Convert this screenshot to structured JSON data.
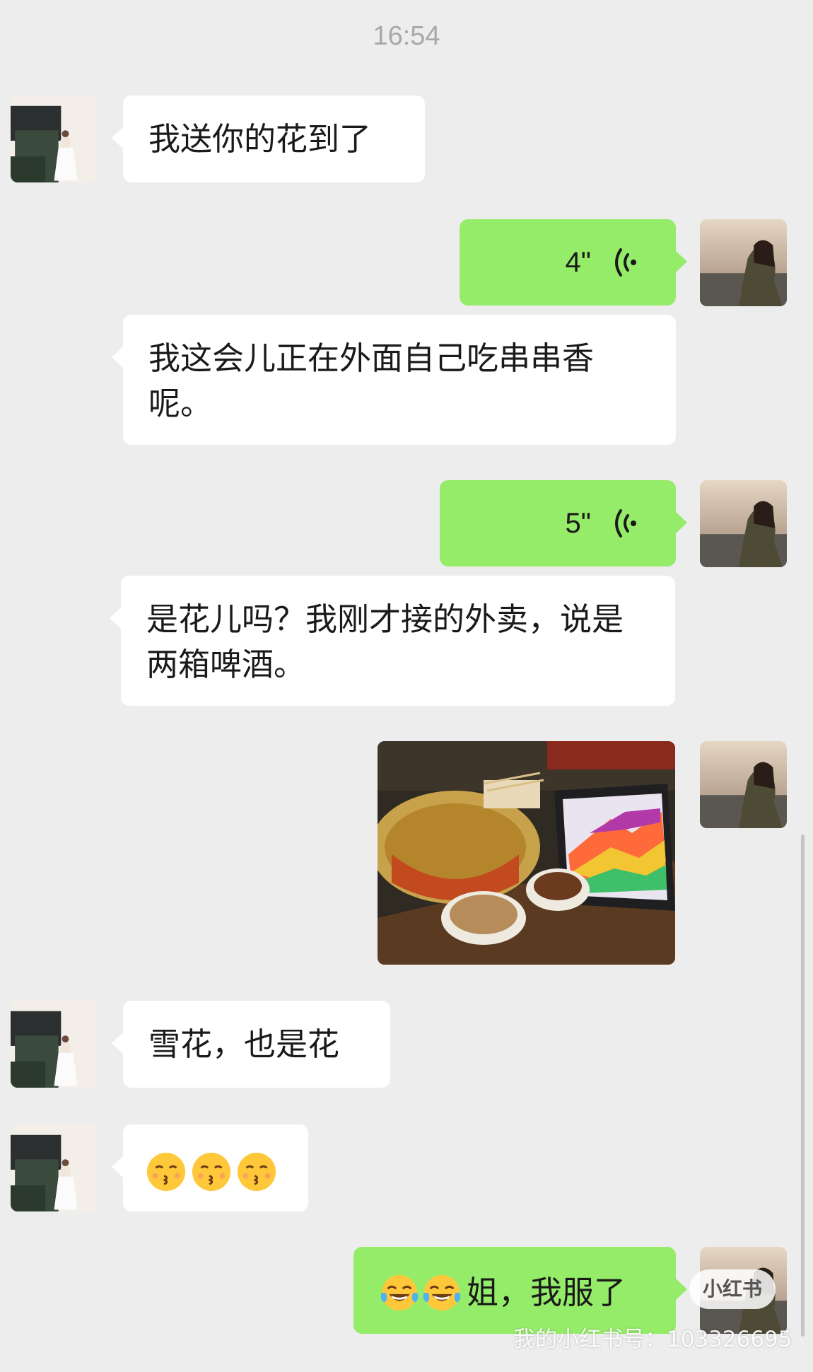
{
  "header": {
    "timestamp": "16:54"
  },
  "messages": [
    {
      "text": "我送你的花到了"
    },
    {
      "duration": "4\""
    },
    {
      "text": "我这会儿正在外面自己吃串串香呢。"
    },
    {
      "duration": "5\""
    },
    {
      "text": "是花儿吗？我刚才接的外卖，说是两箱啤酒。"
    },
    {
      "image": "hotpot-table-photo"
    },
    {
      "text": "雪花，也是花"
    },
    {
      "emoji_icons": [
        "kissing-face-icon",
        "kissing-face-icon",
        "kissing-face-icon"
      ]
    },
    {
      "text": "姐，我服了",
      "emoji_icons": [
        "tears-of-joy-icon",
        "tears-of-joy-icon"
      ]
    }
  ],
  "watermark": {
    "logo": "小红书",
    "text": "我的小红书号：103326695"
  },
  "colors": {
    "background": "#ededed",
    "outgoing_bubble": "#95ec69",
    "incoming_bubble": "#ffffff",
    "timestamp": "#a8a8a8"
  }
}
